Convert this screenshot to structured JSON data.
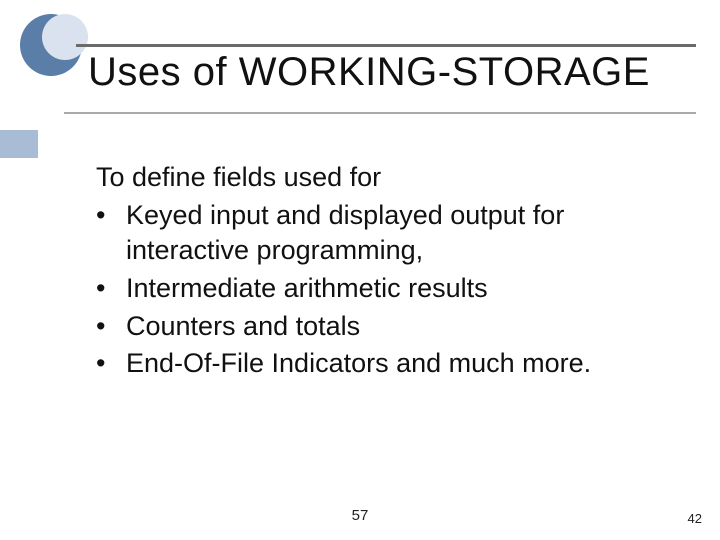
{
  "slide": {
    "title": "Uses of WORKING-STORAGE",
    "lead": "To define fields used for",
    "bullets": [
      "Keyed input and displayed output for interactive programming,",
      "Intermediate arithmetic results",
      "Counters and totals",
      "End-Of-File Indicators  and much more."
    ],
    "footer_center": "57",
    "footer_right": "42"
  }
}
